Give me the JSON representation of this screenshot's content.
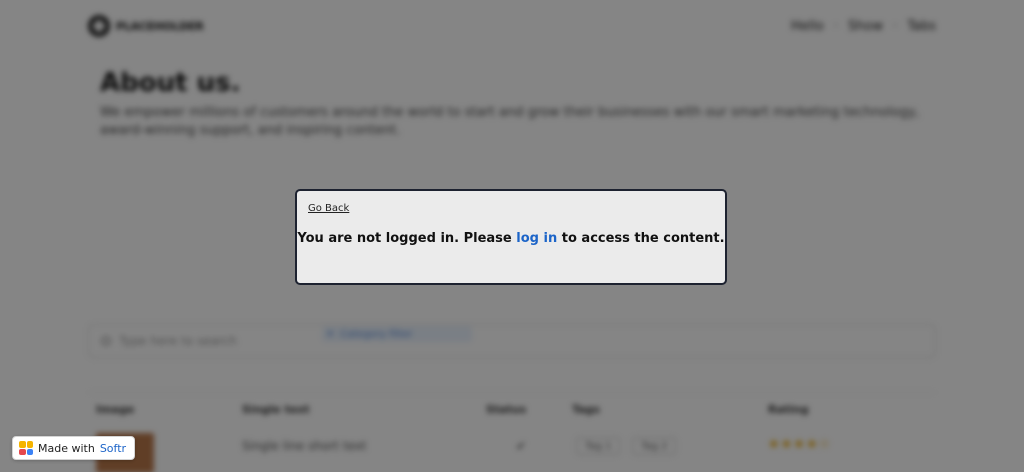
{
  "background": {
    "logo_text": "PLACEHOLDER",
    "nav": [
      "Hello",
      "Show",
      "Tabs"
    ],
    "hero_title": "About us.",
    "hero_text": "We empower millions of customers around the world to start and grow their businesses with our smart marketing technology, award-winning support, and inspiring content.",
    "search_placeholder": "Type here to search",
    "category_filter": "Category filter",
    "table_headers": [
      "Image",
      "Single text",
      "Status",
      "Tags",
      "Rating"
    ],
    "row": {
      "text": "Single line short text",
      "status_icon": "checkmark-icon",
      "tags": [
        "Tag 1",
        "Tag 2"
      ],
      "rating": "★★★★☆"
    }
  },
  "modal": {
    "go_back": "Go Back",
    "message_before": "You are not logged in. Please",
    "login_link": "log in",
    "message_after": "to access the content."
  },
  "badge": {
    "prefix": "Made with",
    "brand": "Softr"
  },
  "colors": {
    "overlay": "rgba(0,0,0,0.48)",
    "modal_bg": "#ebebeb",
    "modal_border": "#1d2230",
    "link": "#1c64c8"
  }
}
